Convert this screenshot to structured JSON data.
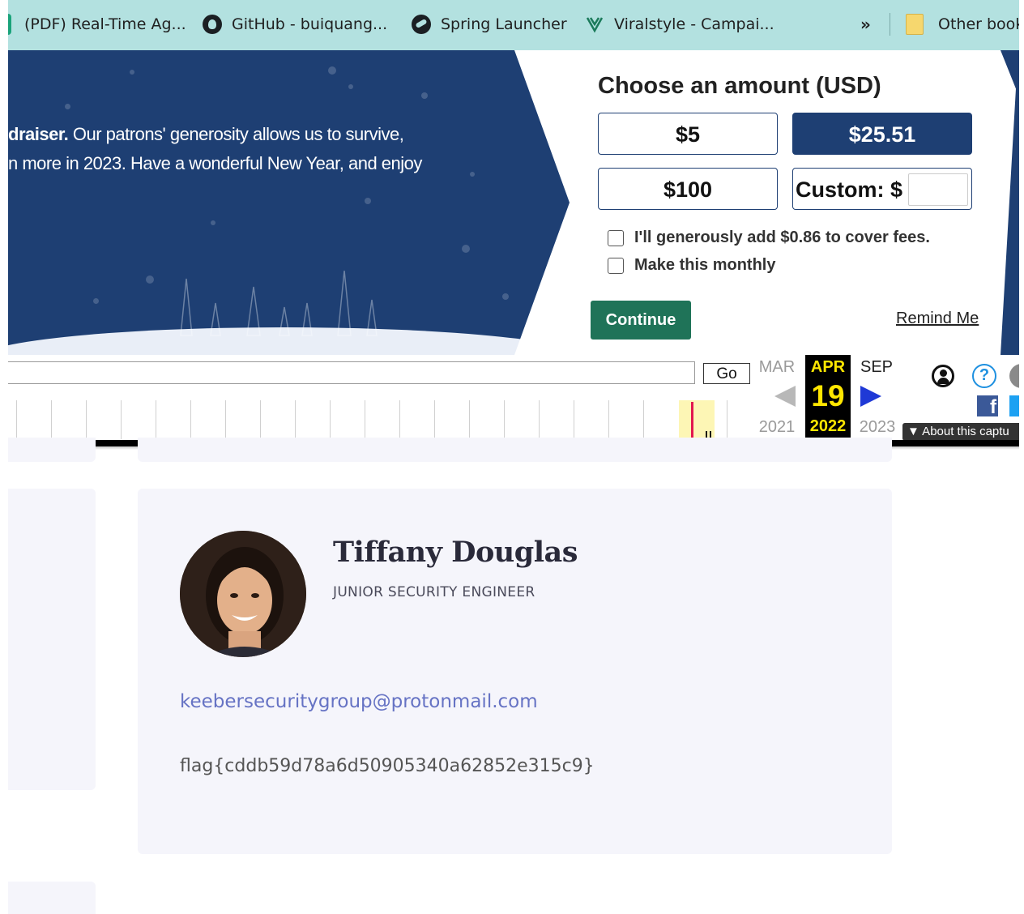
{
  "bookmarks": {
    "items": [
      {
        "label": "(PDF) Real-Time Ag..."
      },
      {
        "label": "GitHub - buiquang..."
      },
      {
        "label": "Spring Launcher"
      },
      {
        "label": "Viralstyle - Campai..."
      }
    ],
    "more": "»",
    "other": "Other book"
  },
  "banner": {
    "line1_bold": "draiser.",
    "line1_rest": " Our patrons' generosity allows us to survive,",
    "line2": "n more in 2023. Have a wonderful New Year, and enjoy"
  },
  "donate": {
    "title": "Choose an amount (USD)",
    "amounts": [
      "$5",
      "$25.51",
      "$100"
    ],
    "selected_amount": "$25.51",
    "custom_label": "Custom: $",
    "custom_value": "",
    "fees_label": "I'll generously add $0.86 to cover fees.",
    "monthly_label": "Make this monthly",
    "continue_label": "Continue",
    "remind_label": "Remind Me"
  },
  "wayback": {
    "url_value": "",
    "go_label": "Go",
    "prev_month": "MAR",
    "cur_month": "APR",
    "next_month": "SEP",
    "cur_day": "19",
    "prev_year": "2021",
    "cur_year": "2022",
    "next_year": "2023",
    "help_glyph": "?",
    "fb_glyph": "f",
    "about_label": "▼ About this captu"
  },
  "profile": {
    "name": "Tiffany Douglas",
    "title": "JUNIOR SECURITY ENGINEER",
    "email": "keebersecuritygroup@protonmail.com",
    "flag": "flag{cddb59d78a6d50905340a62852e315c9}"
  },
  "colors": {
    "bookmark_bar": "#b3e1e0",
    "banner_blue": "#1e3f73",
    "continue_green": "#1f7358",
    "card_bg": "#f5f5fb",
    "email_link": "#6673c4"
  }
}
